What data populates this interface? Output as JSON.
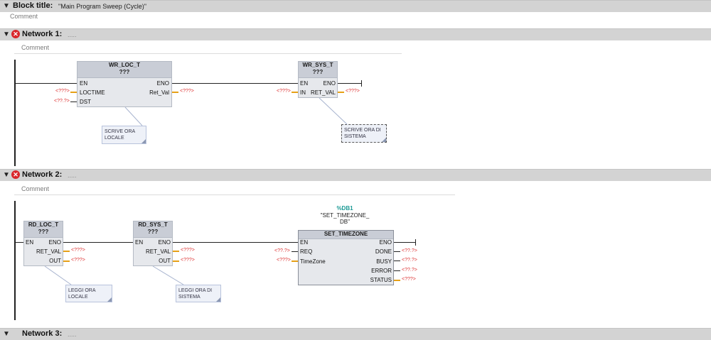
{
  "block": {
    "title_label": "Block title:",
    "title_value": "\"Main Program Sweep (Cycle)\"",
    "comment": "Comment"
  },
  "network1": {
    "label": "Network 1:",
    "dots": ".....",
    "comment": "Comment",
    "wr_loc": {
      "name": "WR_LOC_T",
      "type": "???",
      "en": "EN",
      "eno": "ENO",
      "loctime": "LOCTIME",
      "dst": "DST",
      "ret": "Ret_Val",
      "p_loctime": "<???>",
      "p_dst": "<??.?>",
      "p_ret": "<???>"
    },
    "wr_sys": {
      "name": "WR_SYS_T",
      "type": "???",
      "en": "EN",
      "eno": "ENO",
      "in": "IN",
      "ret": "RET_VAL",
      "p_in": "<???>",
      "p_ret": "<???>"
    },
    "note1": {
      "line1": "SCRIVE ORA",
      "line2": "LOCALE"
    },
    "note2": {
      "line1": "SCRIVE ORA DI",
      "line2": "SISTEMA"
    }
  },
  "network2": {
    "label": "Network 2:",
    "dots": ".....",
    "comment": "Comment",
    "rd_loc": {
      "name": "RD_LOC_T",
      "type": "???",
      "en": "EN",
      "eno": "ENO",
      "ret": "RET_VAL",
      "out": "OUT",
      "p_ret": "<???>",
      "p_out": "<???>"
    },
    "rd_sys": {
      "name": "RD_SYS_T",
      "type": "???",
      "en": "EN",
      "eno": "ENO",
      "ret": "RET_VAL",
      "out": "OUT",
      "p_ret": "<???>",
      "p_out": "<???>"
    },
    "settz": {
      "db_tag": "%DB1",
      "db_name1": "\"SET_TIMEZONE_",
      "db_name2": "DB\"",
      "name": "SET_TIMEZONE",
      "en": "EN",
      "eno": "ENO",
      "req": "REQ",
      "timezone": "TimeZone",
      "done": "DONE",
      "busy": "BUSY",
      "error": "ERROR",
      "status": "STATUS",
      "p_req": "<??.?>",
      "p_tz": "<???>",
      "p_done": "<??.?>",
      "p_busy": "<??.?>",
      "p_error": "<??.?>",
      "p_status": "<???>"
    },
    "note1": {
      "line1": "LEGGI ORA",
      "line2": "LOCALE"
    },
    "note2": {
      "line1": "LEGGI ORA DI",
      "line2": "SISTEMA"
    }
  },
  "network3": {
    "label": "Network 3:",
    "dots": "....."
  }
}
